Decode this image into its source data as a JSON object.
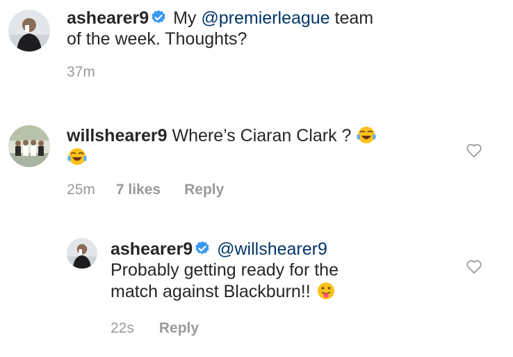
{
  "post": {
    "username": "ashearer9",
    "caption_prefix": "My",
    "mention": "@premierleague",
    "caption_line1_rest": "team",
    "caption_line2": "of the week. Thoughts?",
    "time": "37m"
  },
  "comment": {
    "username": "willshearer9",
    "text": "Where’s  Ciaran Clark ?",
    "emoji": "face-with-tears-of-joy",
    "time": "25m",
    "likes": "7 likes",
    "reply_label": "Reply"
  },
  "reply": {
    "username": "ashearer9",
    "mention": "@willshearer9",
    "line2": "Probably getting ready for the",
    "line3": "match against Blackburn!!",
    "emoji": "face-with-tongue",
    "time": "22s",
    "reply_label": "Reply"
  },
  "colors": {
    "verified": "#3897f0",
    "mention": "#003569",
    "meta": "#999999"
  }
}
